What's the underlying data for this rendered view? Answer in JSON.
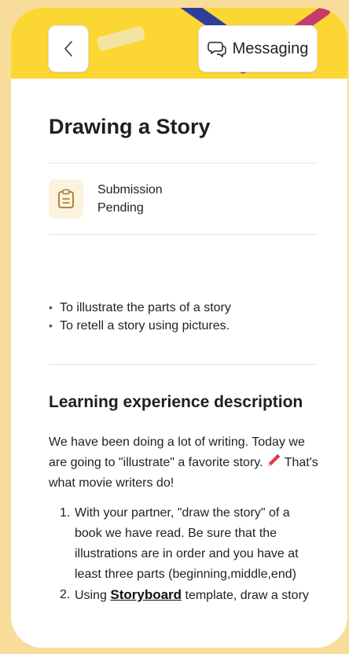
{
  "header": {
    "back_icon": "chevron-left-icon",
    "messaging_label": "Messaging",
    "messaging_icon": "chat-bubble-icon"
  },
  "activity": {
    "title": "Drawing a Story",
    "status_icon": "clipboard-icon",
    "status_line1": "Submission",
    "status_line2": "Pending"
  },
  "objectives": [
    "To illustrate the parts of a story",
    "To retell a story using pictures."
  ],
  "learning": {
    "heading": "Learning experience description",
    "intro_before_emoji": "We have been doing a lot of writing. Today we are going to \"illustrate\" a favorite story.",
    "emoji_icon": "pencil-icon",
    "intro_after_emoji": " That's what movie writers do!",
    "steps": [
      {
        "number": "1.",
        "text": "With your partner, \"draw the story\" of a book we have read. Be sure that the illustrations are in order and you have at least three parts (beginning,middle,end)"
      },
      {
        "number": "2.",
        "text_before_link": "Using ",
        "link_text": "Storyboard",
        "text_after_link": " template, draw a story"
      }
    ]
  }
}
